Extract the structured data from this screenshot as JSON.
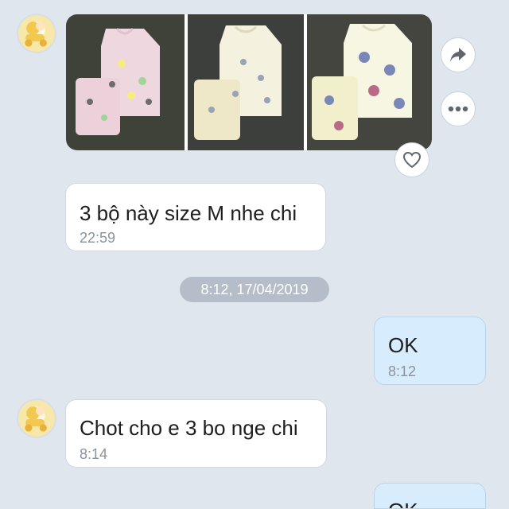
{
  "conversation": {
    "photo_message": {
      "photo_count": 3,
      "actions": {
        "share_icon": "share-icon",
        "more_icon": "more-icon",
        "react_icon": "heart-icon"
      }
    },
    "messages": [
      {
        "side": "them",
        "text": "3 bộ này size M nhe chi",
        "time": "22:59"
      },
      {
        "side": "me",
        "text": "OK",
        "time": "8:12"
      },
      {
        "side": "them",
        "text": "Chot cho e 3 bo nge chi",
        "time": "8:14"
      },
      {
        "side": "me",
        "text": "OK",
        "time": ""
      }
    ],
    "date_separator": "8:12, 17/04/2019"
  },
  "colors": {
    "background": "#e0e6ee",
    "incoming_bubble": "#ffffff",
    "outgoing_bubble": "#d7ecfc",
    "date_pill": "#b5bec8"
  }
}
